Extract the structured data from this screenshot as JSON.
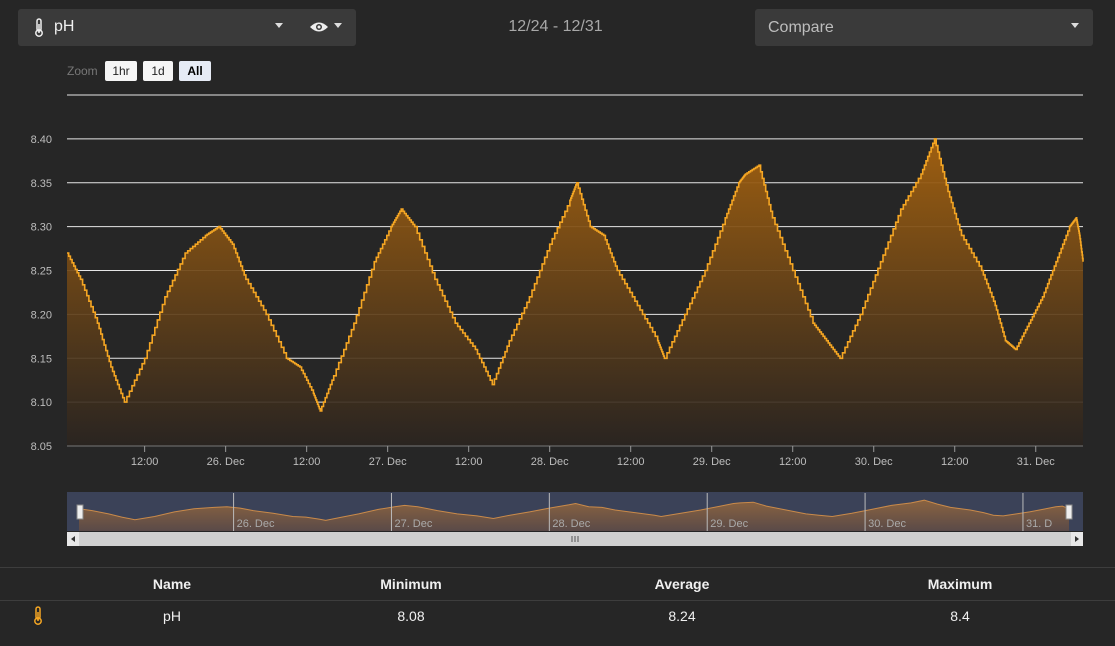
{
  "header": {
    "parameter": "pH",
    "date_range": "12/24 - 12/31",
    "compare_placeholder": "Compare",
    "accent_color": "#f5a623"
  },
  "zoom": {
    "label": "Zoom",
    "buttons": [
      "1hr",
      "1d",
      "All"
    ],
    "active": "All"
  },
  "chart_data": {
    "type": "area",
    "title": "",
    "xlabel": "",
    "ylabel": "",
    "ylim": [
      8.05,
      8.45
    ],
    "yticks": [
      "8.05",
      "8.10",
      "8.15",
      "8.20",
      "8.25",
      "8.30",
      "8.35",
      "8.40"
    ],
    "xlim": [
      "12/25 00:30",
      "12/31 06:00"
    ],
    "xticks": [
      {
        "t": "12/25 12:00",
        "label": "12:00"
      },
      {
        "t": "12/26 00:00",
        "label": "26. Dec"
      },
      {
        "t": "12/26 12:00",
        "label": "12:00"
      },
      {
        "t": "12/27 00:00",
        "label": "27. Dec"
      },
      {
        "t": "12/27 12:00",
        "label": "12:00"
      },
      {
        "t": "12/28 00:00",
        "label": "28. Dec"
      },
      {
        "t": "12/28 12:00",
        "label": "12:00"
      },
      {
        "t": "12/29 00:00",
        "label": "29. Dec"
      },
      {
        "t": "12/29 12:00",
        "label": "12:00"
      },
      {
        "t": "12/30 00:00",
        "label": "30. Dec"
      },
      {
        "t": "12/30 12:00",
        "label": "12:00"
      },
      {
        "t": "12/31 00:00",
        "label": "31. Dec"
      }
    ],
    "series": [
      {
        "name": "pH",
        "color": "#f5a623",
        "points": [
          [
            "12/25 00:30",
            8.27
          ],
          [
            "12/25 02:30",
            8.24
          ],
          [
            "12/25 05:00",
            8.19
          ],
          [
            "12/25 07:00",
            8.14
          ],
          [
            "12/25 09:00",
            8.1
          ],
          [
            "12/25 12:00",
            8.15
          ],
          [
            "12/25 15:00",
            8.22
          ],
          [
            "12/25 18:00",
            8.27
          ],
          [
            "12/25 21:00",
            8.29
          ],
          [
            "12/25 23:00",
            8.3
          ],
          [
            "12/26 01:00",
            8.28
          ],
          [
            "12/26 03:00",
            8.24
          ],
          [
            "12/26 06:00",
            8.2
          ],
          [
            "12/26 09:00",
            8.15
          ],
          [
            "12/26 11:00",
            8.14
          ],
          [
            "12/26 13:00",
            8.11
          ],
          [
            "12/26 14:00",
            8.09
          ],
          [
            "12/26 16:00",
            8.13
          ],
          [
            "12/26 19:00",
            8.19
          ],
          [
            "12/26 22:00",
            8.26
          ],
          [
            "12/27 00:30",
            8.3
          ],
          [
            "12/27 02:00",
            8.32
          ],
          [
            "12/27 04:00",
            8.3
          ],
          [
            "12/27 07:00",
            8.24
          ],
          [
            "12/27 10:00",
            8.19
          ],
          [
            "12/27 13:00",
            8.16
          ],
          [
            "12/27 15:30",
            8.12
          ],
          [
            "12/27 18:00",
            8.17
          ],
          [
            "12/27 21:00",
            8.22
          ],
          [
            "12/28 00:00",
            8.28
          ],
          [
            "12/28 03:00",
            8.33
          ],
          [
            "12/28 04:00",
            8.35
          ],
          [
            "12/28 06:00",
            8.3
          ],
          [
            "12/28 08:00",
            8.29
          ],
          [
            "12/28 10:00",
            8.25
          ],
          [
            "12/28 13:00",
            8.21
          ],
          [
            "12/28 16:00",
            8.17
          ],
          [
            "12/28 17:00",
            8.15
          ],
          [
            "12/28 20:00",
            8.2
          ],
          [
            "12/28 23:00",
            8.25
          ],
          [
            "12/29 02:00",
            8.31
          ],
          [
            "12/29 04:00",
            8.35
          ],
          [
            "12/29 05:00",
            8.36
          ],
          [
            "12/29 07:00",
            8.37
          ],
          [
            "12/29 09:00",
            8.31
          ],
          [
            "12/29 12:00",
            8.25
          ],
          [
            "12/29 15:00",
            8.19
          ],
          [
            "12/29 17:00",
            8.17
          ],
          [
            "12/29 19:00",
            8.15
          ],
          [
            "12/29 22:00",
            8.2
          ],
          [
            "12/30 01:00",
            8.26
          ],
          [
            "12/30 04:00",
            8.32
          ],
          [
            "12/30 07:00",
            8.36
          ],
          [
            "12/30 09:00",
            8.4
          ],
          [
            "12/30 11:00",
            8.34
          ],
          [
            "12/30 13:00",
            8.29
          ],
          [
            "12/30 16:00",
            8.25
          ],
          [
            "12/30 18:00",
            8.21
          ],
          [
            "12/30 19:30",
            8.17
          ],
          [
            "12/30 21:00",
            8.16
          ],
          [
            "12/30 23:00",
            8.19
          ],
          [
            "12/31 01:00",
            8.22
          ],
          [
            "12/31 03:00",
            8.26
          ],
          [
            "12/31 05:00",
            8.3
          ],
          [
            "12/31 06:00",
            8.31
          ],
          [
            "12/31 06:30",
            8.29
          ],
          [
            "12/31 07:00",
            8.26
          ]
        ]
      }
    ],
    "navigator_labels": [
      "26. Dec",
      "27. Dec",
      "28. Dec",
      "29. Dec",
      "30. Dec",
      "31. D"
    ],
    "grid": true
  },
  "stats": {
    "headers": {
      "name": "Name",
      "min": "Minimum",
      "avg": "Average",
      "max": "Maximum"
    },
    "row": {
      "name": "pH",
      "min": "8.08",
      "avg": "8.24",
      "max": "8.4"
    }
  }
}
